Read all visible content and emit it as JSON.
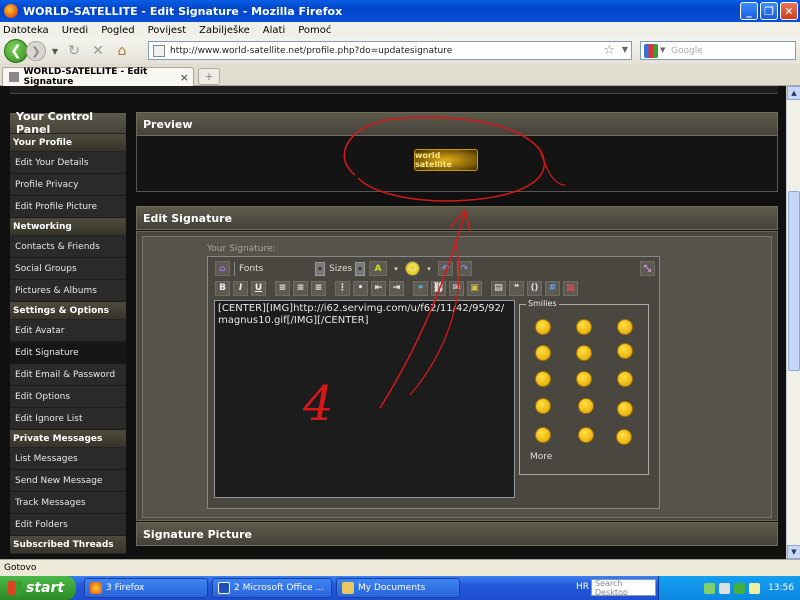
{
  "window": {
    "title": "WORLD-SATELLITE - Edit Signature - Mozilla Firefox"
  },
  "menu": [
    "Datoteka",
    "Uredi",
    "Pogled",
    "Povijest",
    "Zabilješke",
    "Alati",
    "Pomoć"
  ],
  "nav": {
    "url": "http://www.world-satellite.net/profile.php?do=updatesignature",
    "search_placeholder": "Google"
  },
  "tab": {
    "label": "WORLD-SATELLITE - Edit Signature"
  },
  "sidebar": {
    "title": "Your Control Panel",
    "sections": [
      {
        "label": "Your Profile",
        "items": [
          "Edit Your Details",
          "Profile Privacy",
          "Edit Profile Picture"
        ]
      },
      {
        "label": "Networking",
        "items": [
          "Contacts & Friends",
          "Social Groups",
          "Pictures & Albums"
        ]
      },
      {
        "label": "Settings & Options",
        "items": [
          "Edit Avatar",
          "Edit Signature",
          "Edit Email & Password",
          "Edit Options",
          "Edit Ignore List"
        ]
      },
      {
        "label": "Private Messages",
        "items": [
          "List Messages",
          "Send New Message",
          "Track Messages",
          "Edit Folders"
        ]
      },
      {
        "label": "Subscribed Threads",
        "items": []
      }
    ]
  },
  "preview": {
    "title": "Preview",
    "image_text": "world satellite"
  },
  "edit_signature": {
    "title": "Edit Signature",
    "label": "Your Signature:",
    "fonts_label": "Fonts",
    "sizes_label": "Sizes",
    "text": "[CENTER][IMG]http://i62.servimg.com/u/f62/11/42/95/92/magnus10.gif[/IMG][/CENTER]",
    "smilies_label": "Smilies",
    "more_label": "More"
  },
  "signature_picture": {
    "title": "Signature Picture"
  },
  "annotation": {
    "number": "4",
    "color": "#d81818"
  },
  "status": "Gotovo",
  "taskbar": {
    "start": "start",
    "tasks": [
      "3 Firefox",
      "2 Microsoft Office ...",
      "My Documents"
    ],
    "lang": "HR",
    "search": "Search Desktop",
    "clock": "13:56"
  }
}
